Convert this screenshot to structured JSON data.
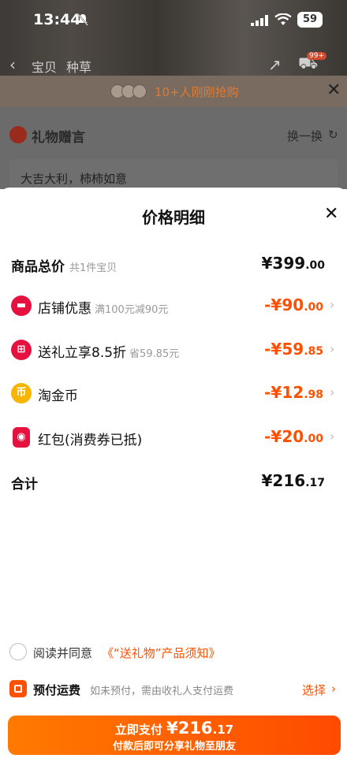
{
  "status_bar": {
    "time": "13:44",
    "battery": "59"
  },
  "background": {
    "nav": {
      "tab_item": "宝贝",
      "tab_seed": "种草",
      "cart_badge": "99+"
    },
    "banner": {
      "text": "10+人刚刚抢购"
    },
    "gift": {
      "title": "礼物赠言",
      "swap_label": "换一换",
      "message": "大吉大利，柿柿如意"
    }
  },
  "sheet": {
    "title": "价格明细",
    "total_goods": {
      "label": "商品总价",
      "sub": "共1件宝贝",
      "amount_main": "¥399",
      "amount_cents": ".00"
    },
    "items": [
      {
        "label": "店铺优惠",
        "sub": "满100元减90元",
        "amount_main": "-¥90",
        "amount_cents": ".00",
        "icon": "shop-icon"
      },
      {
        "label": "送礼立享8.5折",
        "sub": "省59.85元",
        "amount_main": "-¥59",
        "amount_cents": ".85",
        "icon": "gift-icon"
      },
      {
        "label": "淘金币",
        "sub": "",
        "amount_main": "-¥12",
        "amount_cents": ".98",
        "icon": "coin-icon"
      },
      {
        "label": "红包(消费券已抵)",
        "sub": "",
        "amount_main": "-¥20",
        "amount_cents": ".00",
        "icon": "red-envelope-icon"
      }
    ],
    "total": {
      "label": "合计",
      "amount_main": "¥216",
      "amount_cents": ".17"
    }
  },
  "agreement": {
    "prefix": "阅读并同意",
    "link": "《“送礼物”产品须知》"
  },
  "shipping": {
    "label": "预付运费",
    "desc": "如未预付，需由收礼人支付运费",
    "select": "选择"
  },
  "pay_button": {
    "prefix": "立即支付 ",
    "amount_main": "¥216",
    "amount_cents": ".17",
    "subtitle": "付款后即可分享礼物至朋友"
  },
  "colors": {
    "accent": "#ff5000",
    "discount": "#ff5000",
    "coin": "#f7b500",
    "red": "#e5123f"
  }
}
